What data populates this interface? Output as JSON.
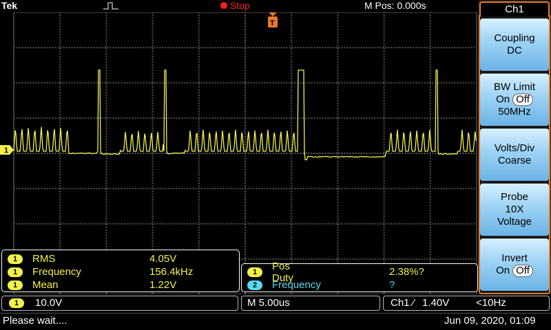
{
  "topbar": {
    "brand": "Tek",
    "trigger_icon": "pulse-trigger-icon",
    "run_state": "Stop",
    "mpos": "M Pos: 0.000s"
  },
  "colors": {
    "ch1": "#f2f24a",
    "ch2": "#5ad8f0",
    "accent": "#e87a2a",
    "stop": "#ff2020"
  },
  "markers": {
    "ch1_level_badge": "1",
    "trigger_badge": "T"
  },
  "measurements_left": [
    {
      "ch": "1",
      "label": "RMS",
      "value": "4.05V"
    },
    {
      "ch": "1",
      "label": "Frequency",
      "value": "156.4kHz"
    },
    {
      "ch": "1",
      "label": "Mean",
      "value": "1.22V"
    }
  ],
  "measurements_right": [
    {
      "ch": "1",
      "label": "Pos Duty",
      "value": "2.38%?"
    },
    {
      "ch": "2",
      "label": "Frequency",
      "value": "?"
    }
  ],
  "info": {
    "ch1_badge": "1",
    "ch1_scale": "10.0V",
    "timebase": "M 5.00us",
    "trigger_source": "Ch1",
    "trigger_slope": "⁄",
    "trigger_level": "1.40V",
    "trigger_freq": "<10Hz"
  },
  "status": {
    "message": "Please wait....",
    "datetime": "Jun 09, 2020, 01:09"
  },
  "side_menu": {
    "title": "Ch1",
    "buttons": [
      {
        "line1": "Coupling",
        "line2": "DC"
      },
      {
        "line1": "BW Limit",
        "line2_prefix": "On",
        "toggle": "Off",
        "line3": "50MHz"
      },
      {
        "line1": "Volts/Div",
        "line2": "Coarse"
      },
      {
        "line1": "Probe",
        "line2": "10X",
        "line3": "Voltage"
      },
      {
        "line1": "Invert",
        "line2_prefix": "On",
        "toggle": "Off"
      }
    ]
  }
}
